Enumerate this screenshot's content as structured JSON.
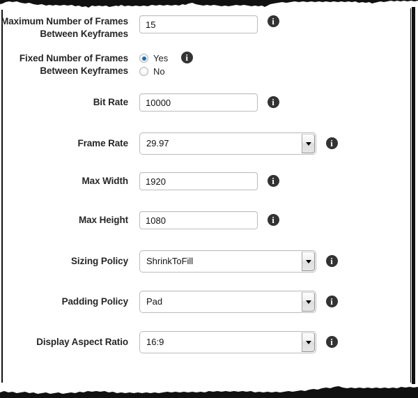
{
  "form": {
    "fields": [
      {
        "id": "max-keyframes",
        "label": "Maximum Number of Frames Between Keyframes",
        "type": "text",
        "value": "15",
        "info_icon": "info-icon"
      },
      {
        "id": "fixed-keyframes",
        "label": "Fixed Number of Frames Between Keyframes",
        "type": "radio",
        "options": [
          {
            "label": "Yes",
            "selected": true
          },
          {
            "label": "No",
            "selected": false
          }
        ],
        "info_icon": "info-icon"
      },
      {
        "id": "bit-rate",
        "label": "Bit Rate",
        "type": "text",
        "value": "10000",
        "info_icon": "info-icon"
      },
      {
        "id": "frame-rate",
        "label": "Frame Rate",
        "type": "select",
        "value": "29.97",
        "info_icon": "info-icon"
      },
      {
        "id": "max-width",
        "label": "Max Width",
        "type": "text",
        "value": "1920",
        "info_icon": "info-icon"
      },
      {
        "id": "max-height",
        "label": "Max Height",
        "type": "text",
        "value": "1080",
        "info_icon": "info-icon"
      },
      {
        "id": "sizing-policy",
        "label": "Sizing Policy",
        "type": "select",
        "value": "ShrinkToFill",
        "info_icon": "info-icon"
      },
      {
        "id": "padding-policy",
        "label": "Padding Policy",
        "type": "select",
        "value": "Pad",
        "info_icon": "info-icon"
      },
      {
        "id": "display-aspect-ratio",
        "label": "Display Aspect Ratio",
        "type": "select",
        "value": "16:9",
        "info_icon": "info-icon"
      }
    ],
    "info_glyph": "i"
  },
  "colors": {
    "label_text": "#262626",
    "border": "#bcbcbc",
    "info_bg": "#333333",
    "radio_selected": "#1a6fb5",
    "torn_edge": "#111111"
  }
}
